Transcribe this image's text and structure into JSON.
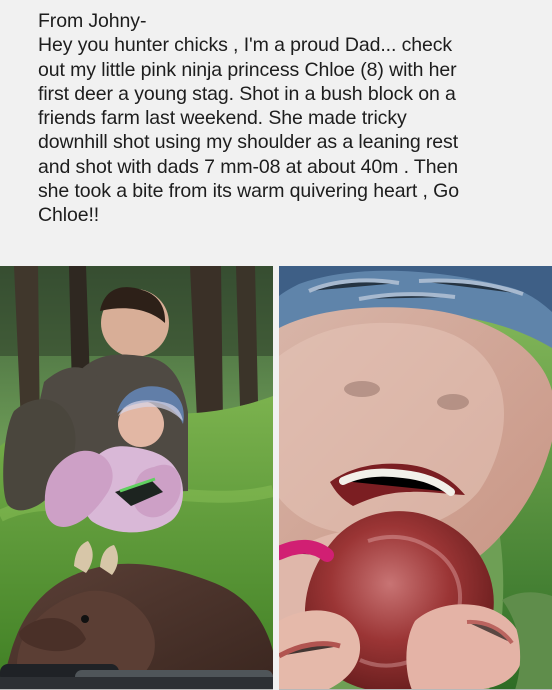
{
  "post": {
    "lines": [
      "From Johny-",
      "Hey you hunter chicks , I'm a proud Dad... check",
      "out my little pink ninja princess Chloe (8) with her",
      "first deer a young stag. Shot in a bush block on a",
      "friends farm last weekend. She made  tricky",
      "downhill shot using my shoulder as a leaning rest",
      "and shot with dads 7 mm-08 at about 40m . Then",
      "she took a bite from its warm quivering heart , Go",
      "Chloe!!"
    ]
  },
  "colors": {
    "background": "#f1f1f1",
    "text": "#1d1d1d"
  },
  "photos": [
    {
      "name": "hunting-photo"
    },
    {
      "name": "heart-photo"
    }
  ]
}
